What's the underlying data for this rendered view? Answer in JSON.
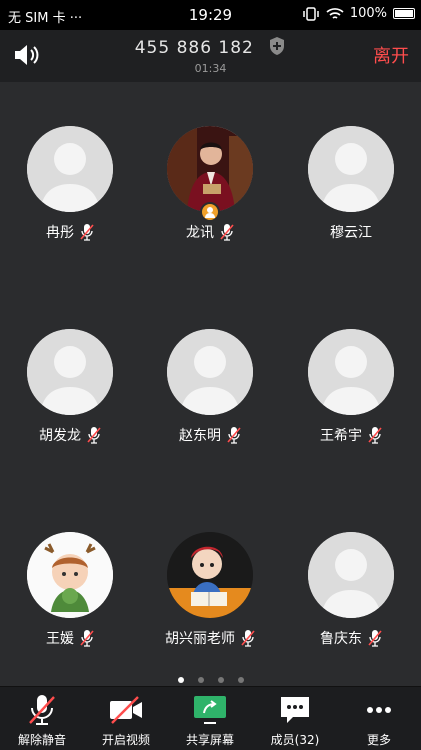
{
  "status_bar": {
    "carrier": "无 SIM 卡 ···",
    "time": "19:29",
    "battery": "100%"
  },
  "header": {
    "number": "455 886 182",
    "timer": "01:34",
    "leave_label": "离开"
  },
  "members": [
    {
      "name": "冉彤",
      "avatar": "default"
    },
    {
      "name": "龙讯",
      "avatar": "photo",
      "host": true
    },
    {
      "name": "穆云江",
      "avatar": "default"
    },
    {
      "name": "胡发龙",
      "avatar": "default"
    },
    {
      "name": "赵东明",
      "avatar": "default"
    },
    {
      "name": "王希宇",
      "avatar": "default"
    },
    {
      "name": "王媛",
      "avatar": "cartoon-deer"
    },
    {
      "name": "胡兴丽老师",
      "avatar": "cartoon-reading"
    },
    {
      "name": "鲁庆东",
      "avatar": "default"
    }
  ],
  "toolbar": {
    "unmute": "解除静音",
    "video": "开启视频",
    "share": "共享屏幕",
    "members": "成员(32)",
    "more": "更多"
  },
  "colors": {
    "leave": "#ff4d4d",
    "share_icon": "#2fb36a",
    "host_badge": "#f0a12a",
    "mute_red": "#ff4d4d"
  }
}
